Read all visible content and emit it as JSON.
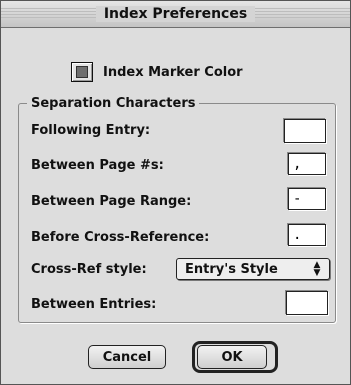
{
  "window": {
    "title": "Index Preferences"
  },
  "marker": {
    "label": "Index Marker Color",
    "color": "#6f6f6f"
  },
  "group": {
    "legend": "Separation Characters",
    "following_entry": {
      "label": "Following Entry:",
      "value": ""
    },
    "between_page_numbers": {
      "label": "Between Page #s:",
      "value": ","
    },
    "between_page_range": {
      "label": "Between Page Range:",
      "value": "-"
    },
    "before_cross_reference": {
      "label": "Before Cross-Reference:",
      "value": "."
    },
    "cross_ref_style": {
      "label": "Cross-Ref style:",
      "selected": "Entry's Style"
    },
    "between_entries": {
      "label": "Between Entries:",
      "value": ""
    }
  },
  "buttons": {
    "cancel": "Cancel",
    "ok": "OK"
  }
}
